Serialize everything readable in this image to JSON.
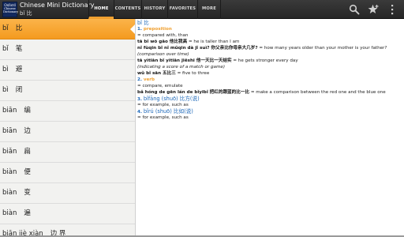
{
  "app": {
    "logo_line1": "Oxford",
    "logo_line2": "Chinese",
    "logo_line3": "Dictionary",
    "title": "Chinese Mini Dictionary",
    "subtitle": "bǐ 比"
  },
  "tabs": [
    {
      "label": "HOME",
      "active": true
    },
    {
      "label": "CONTENTS"
    },
    {
      "label": "HISTORY"
    },
    {
      "label": "FAVORITES"
    },
    {
      "label": "MORE"
    }
  ],
  "toolbar_icons": [
    "search-icon",
    "favorites-star-icon",
    "overflow-menu-icon"
  ],
  "sidebar": {
    "items": [
      {
        "py": "bǐ",
        "hz": "比"
      },
      {
        "py": "bǐ",
        "hz": "笔"
      },
      {
        "py": "bì",
        "hz": "避"
      },
      {
        "py": "bì",
        "hz": "闭"
      },
      {
        "py": "biān",
        "hz": "编"
      },
      {
        "py": "biān",
        "hz": "边"
      },
      {
        "py": "biǎn",
        "hz": "扁"
      },
      {
        "py": "biàn",
        "hz": "便"
      },
      {
        "py": "biàn",
        "hz": "变"
      },
      {
        "py": "biàn",
        "hz": "遍"
      },
      {
        "py": "biān jiè xiàn",
        "hz": "边 界"
      }
    ]
  },
  "entry": {
    "headword": "bǐ 比",
    "s1_num": "1.",
    "s1_pos": "preposition",
    "s1_def": "= compared with, than",
    "ex1_cn": "tā bǐ wǒ gāo 他比我高",
    "ex1_en": "= he is taller than I am",
    "ex2_cn": "nǐ fùqin bǐ nǐ mǔqin dà jǐ suì? 你父亲比你母亲大几岁?",
    "ex2_en": "= how many years older than your mother is your father?",
    "note1": "(comparison over time)",
    "ex3_cn": "tā yìtiān bǐ yìtiān jiēshi 他一天比一天结实",
    "ex3_en": "= he gets stronger every day",
    "note2": "(indicating a score of a match or game)",
    "ex4_cn": "wǔ bǐ sān 五比三",
    "ex4_en": "= five to three",
    "s2_num": "2.",
    "s2_pos": "verb",
    "s2_def": "= compare, emulate",
    "ex5_cn": "bǎ hóng de gēn lán de bǐyibǐ 把红的跟蓝的比一比",
    "ex5_en": "= make a comparison between the red one and the blue one",
    "s3_num": "3.",
    "s3_word": "bǐfāng (shuō) 比方(说)",
    "s3_def": "= for example, such as",
    "s4_num": "4.",
    "s4_word": "bǐrú (shuō) 比如(说)",
    "s4_def": "= for example, such as"
  }
}
